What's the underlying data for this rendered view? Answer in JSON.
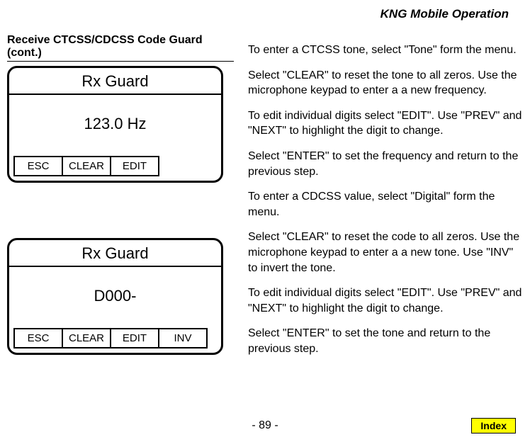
{
  "header": {
    "title": "KNG Mobile Operation"
  },
  "section": {
    "title": "Receive CTCSS/CDCSS Code Guard (cont.)"
  },
  "screen1": {
    "title": "Rx Guard",
    "value": "123.0 Hz",
    "btn_esc": "ESC",
    "btn_clear": "CLEAR",
    "btn_edit": "EDIT"
  },
  "screen2": {
    "title": "Rx Guard",
    "value": "D000-",
    "btn_esc": "ESC",
    "btn_clear": "CLEAR",
    "btn_edit": "EDIT",
    "btn_inv": "INV"
  },
  "body": {
    "p1": "To enter a CTCSS tone, select \"Tone\" form the menu.",
    "p2": "Select \"CLEAR\" to reset the tone to all zeros. Use the microphone keypad to enter a a new frequency.",
    "p3": "To edit individual digits select \"EDIT\". Use \"PREV\" and \"NEXT\" to highlight the digit to change.",
    "p4": "Select \"ENTER\" to set the frequency and return to the previous step.",
    "p5": "To enter a CDCSS value, select \"Digital\" form the menu.",
    "p6": "Select \"CLEAR\" to reset the code to all zeros. Use the microphone keypad to enter a a new tone. Use \"INV\" to invert the tone.",
    "p7": "To edit individual digits select \"EDIT\". Use \"PREV\" and \"NEXT\" to highlight the digit to change.",
    "p8": "Select \"ENTER\" to set the tone and return to the previous step."
  },
  "footer": {
    "page": "- 89 -",
    "index": "Index"
  }
}
